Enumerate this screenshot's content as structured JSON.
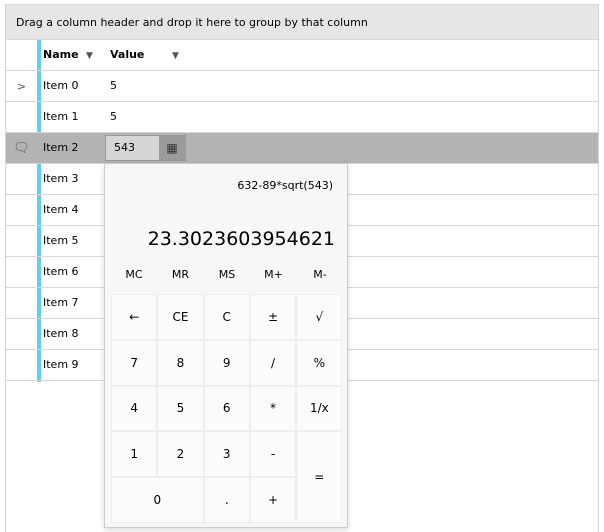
{
  "group_panel": "Drag a column header and drop it here to group by that column",
  "columns": [
    "Name",
    "Value"
  ],
  "rows": [
    {
      "name": "Item 0",
      "value": "5"
    },
    {
      "name": "Item 1",
      "value": "5"
    },
    {
      "name": "Item 2",
      "value": "543"
    },
    {
      "name": "Item 3",
      "value": ""
    },
    {
      "name": "Item 4",
      "value": ""
    },
    {
      "name": "Item 5",
      "value": ""
    },
    {
      "name": "Item 6",
      "value": ""
    },
    {
      "name": "Item 7",
      "value": ""
    },
    {
      "name": "Item 8",
      "value": ""
    },
    {
      "name": "Item 9",
      "value": ""
    }
  ],
  "calculator": {
    "expression": "632-89*sqrt(543)",
    "result": "23.3023603954621",
    "memory": [
      "MC",
      "MR",
      "MS",
      "M+",
      "M-"
    ],
    "keys": [
      "←",
      "CE",
      "C",
      "±",
      "√",
      "7",
      "8",
      "9",
      "/",
      "%",
      "4",
      "5",
      "6",
      "*",
      "1/x",
      "1",
      "2",
      "3",
      "-",
      "=",
      "0",
      ".",
      "+"
    ]
  }
}
